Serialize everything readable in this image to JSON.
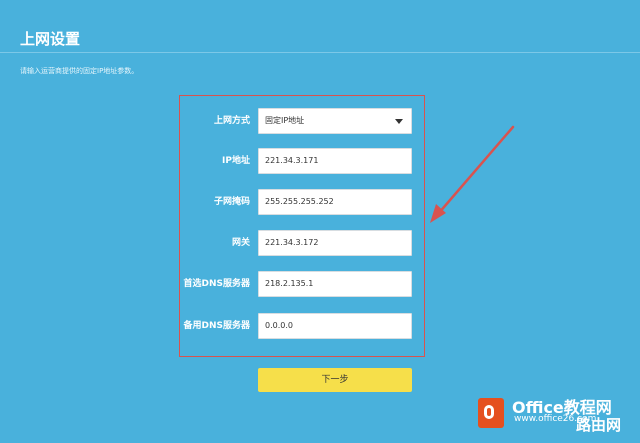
{
  "header": {
    "title": "上网设置"
  },
  "instruction": "请输入运营商提供的固定IP地址参数。",
  "form": {
    "connection_type": {
      "label": "上网方式",
      "value": "固定IP地址"
    },
    "ip_address": {
      "label": "IP地址",
      "value": "221.34.3.171"
    },
    "subnet_mask": {
      "label": "子网掩码",
      "value": "255.255.255.252"
    },
    "gateway": {
      "label": "网关",
      "value": "221.34.3.172"
    },
    "primary_dns": {
      "label": "首选DNS服务器",
      "value": "218.2.135.1"
    },
    "secondary_dns": {
      "label": "备用DNS服务器",
      "value": "0.0.0.0"
    }
  },
  "next_button": "下一步",
  "watermark": {
    "title": "Office教程网",
    "url": "www.office26.com",
    "site": "路由网"
  },
  "colors": {
    "background": "#49b1dc",
    "highlight_border": "#d9534f",
    "arrow": "#d9534f",
    "button": "#f6df4a",
    "watermark_logo": "#e5501f"
  },
  "icons": {
    "select_caret": "chevron-down-icon",
    "arrow": "red-arrow-annotation",
    "watermark_logo": "office-logo-icon"
  }
}
